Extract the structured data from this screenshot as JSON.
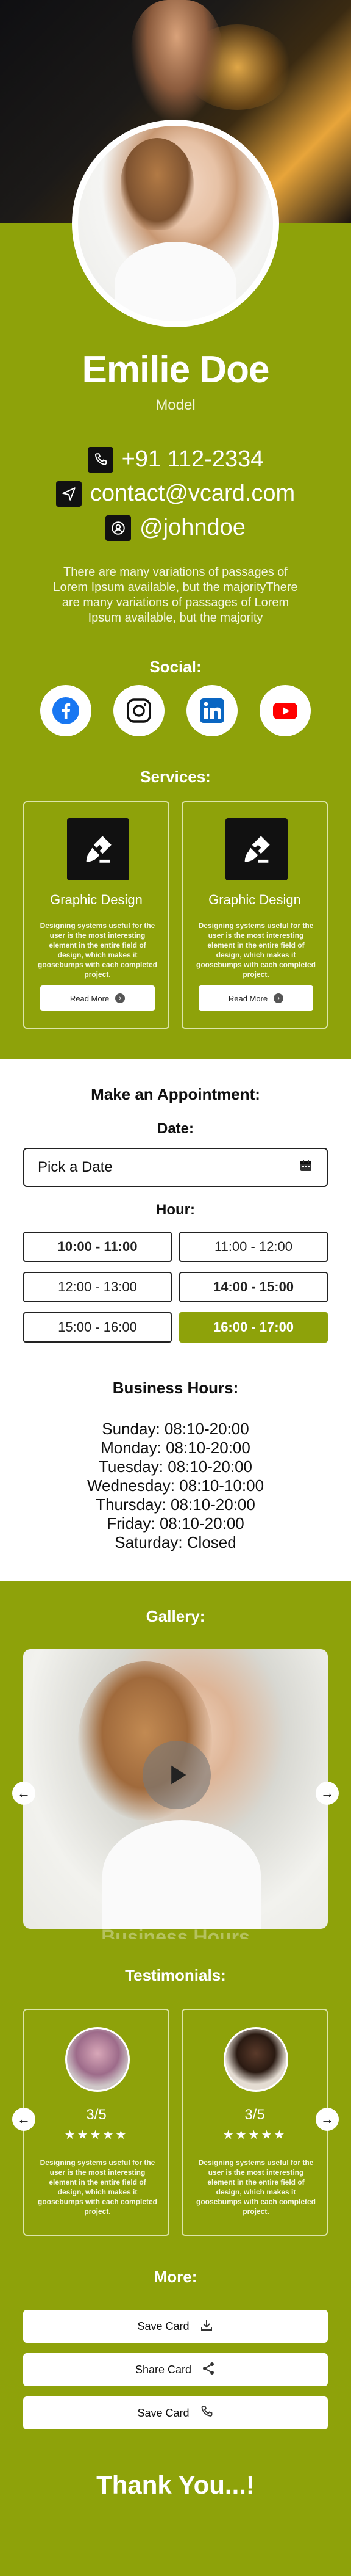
{
  "profile": {
    "name": "Emilie Doe",
    "role": "Model",
    "phone": "+91 112-2334",
    "email": "contact@vcard.com",
    "handle": "@johndoe",
    "about": "There are many variations of passages of Lorem Ipsum available, but the majorityThere are many variations of passages of Lorem Ipsum available, but the majority"
  },
  "social": {
    "title": "Social:",
    "items": [
      "facebook-icon",
      "instagram-icon",
      "linkedin-icon",
      "youtube-icon"
    ]
  },
  "services": {
    "title": "Services:",
    "items": [
      {
        "title": "Graphic Design",
        "desc": "Designing systems useful for the user is the most interesting element in the entire field of design, which makes it goosebumps with each completed project.",
        "button": "Read More"
      },
      {
        "title": "Graphic Design",
        "desc": "Designing systems useful for the user is the most interesting element in the entire field of design, which makes it goosebumps with each completed project.",
        "button": "Read More"
      }
    ]
  },
  "appointment": {
    "title": "Make an Appointment:",
    "date_label": "Date:",
    "date_placeholder": "Pick a Date",
    "hour_label": "Hour:",
    "slots": [
      {
        "label": "10:00 - 11:00",
        "state": "bold"
      },
      {
        "label": "11:00 - 12:00",
        "state": "normal"
      },
      {
        "label": "12:00 - 13:00",
        "state": "normal"
      },
      {
        "label": "14:00 - 15:00",
        "state": "bold"
      },
      {
        "label": "15:00 - 16:00",
        "state": "normal"
      },
      {
        "label": "16:00 - 17:00",
        "state": "selected"
      }
    ]
  },
  "business_hours": {
    "title": "Business Hours:",
    "lines": [
      "Sunday: 08:10-20:00",
      "Monday: 08:10-20:00",
      "Tuesday: 08:10-20:00",
      "Wednesday: 08:10-10:00",
      "Thursday: 08:10-20:00",
      "Friday: 08:10-20:00",
      "Saturday: Closed"
    ]
  },
  "gallery": {
    "title": "Gallery:",
    "ghost_text": "Business Hours"
  },
  "testimonials": {
    "title": "Testimonials:",
    "items": [
      {
        "rating": "3/5",
        "stars": "★★★★★",
        "desc": "Designing systems useful for the user is the most interesting element in the entire field of design, which makes it goosebumps with each completed project."
      },
      {
        "rating": "3/5",
        "stars": "★★★★★",
        "desc": "Designing systems useful for the user is the most interesting element in the entire field of design, which makes it goosebumps with each completed project."
      }
    ]
  },
  "more": {
    "title": "More:",
    "buttons": [
      "Save Card",
      "Share Card",
      "Save Card"
    ]
  },
  "footer": {
    "thanks": "Thank You...!"
  },
  "colors": {
    "accent": "#8ea20a",
    "dark": "#111111"
  }
}
